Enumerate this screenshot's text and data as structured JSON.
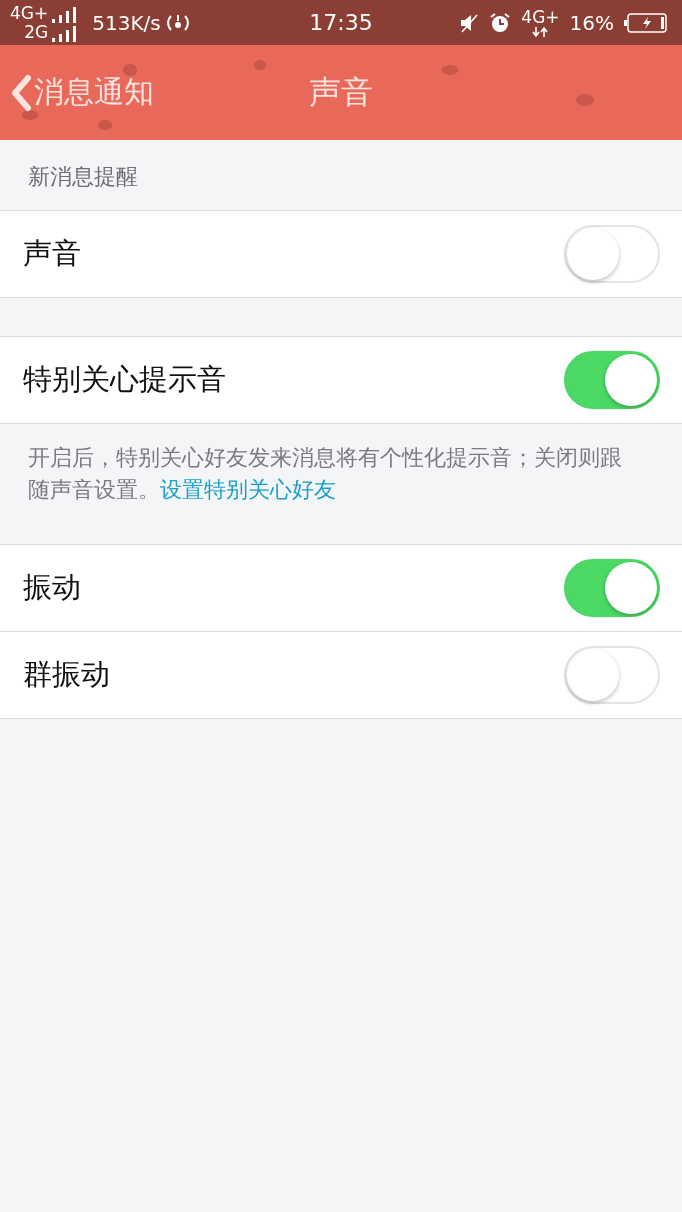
{
  "status_bar": {
    "network_1": "4G+",
    "network_2": "2G",
    "speed": "513K/s",
    "time": "17:35",
    "network_3": "4G+",
    "battery": "16%"
  },
  "nav": {
    "back_label": "消息通知",
    "title": "声音"
  },
  "groups": [
    {
      "header": "新消息提醒",
      "rows": [
        {
          "label": "声音",
          "on": false
        }
      ]
    },
    {
      "rows": [
        {
          "label": "特别关心提示音",
          "on": true
        }
      ],
      "note": {
        "text": "开启后，特别关心好友发来消息将有个性化提示音；关闭则跟随声音设置。",
        "link": "设置特别关心好友"
      }
    },
    {
      "rows": [
        {
          "label": "振动",
          "on": true
        },
        {
          "label": "群振动",
          "on": false
        }
      ]
    }
  ]
}
